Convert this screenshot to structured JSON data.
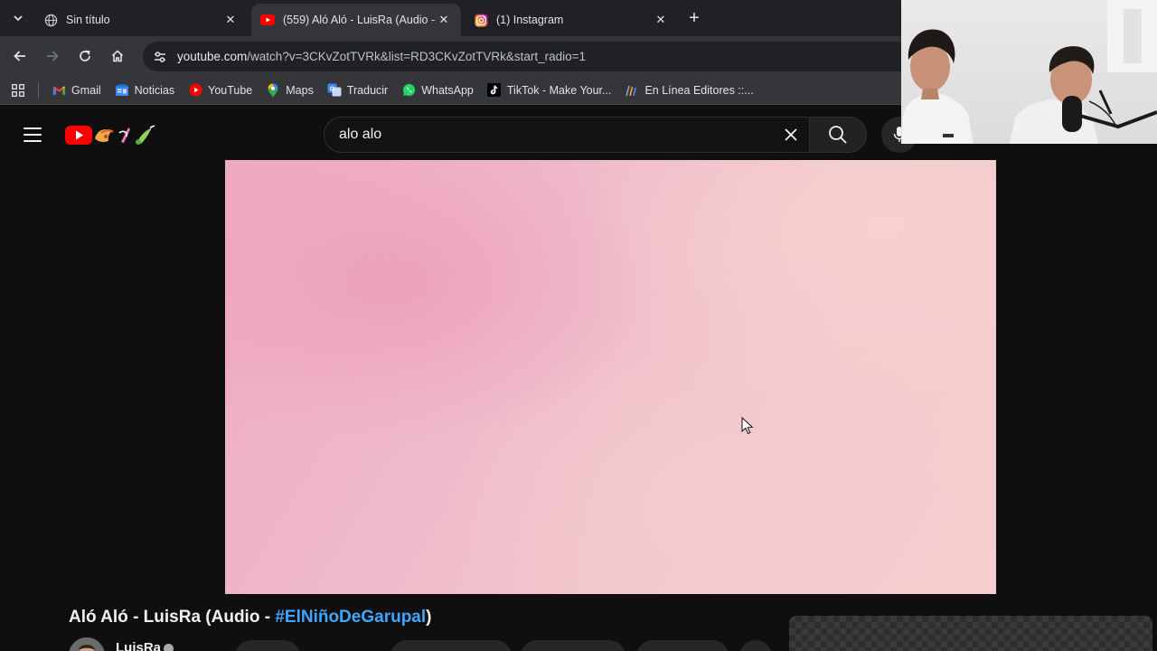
{
  "browser": {
    "tabs": [
      {
        "title": "Sin título",
        "icon": "globe-icon",
        "active": false
      },
      {
        "title": "(559) Aló Aló - LuisRa (Audio - #",
        "icon": "youtube-favicon",
        "active": true
      },
      {
        "title": "(1) Instagram",
        "icon": "instagram-favicon",
        "active": false
      }
    ],
    "url_host": "youtube.com",
    "url_path": "/watch?v=3CKvZotTVRk&list=RD3CKvZotTVRk&start_radio=1",
    "bookmarks": [
      {
        "label": "Gmail",
        "icon": "gmail-icon"
      },
      {
        "label": "Noticias",
        "icon": "news-icon"
      },
      {
        "label": "YouTube",
        "icon": "youtube-icon"
      },
      {
        "label": "Maps",
        "icon": "maps-icon"
      },
      {
        "label": "Traducir",
        "icon": "translate-icon"
      },
      {
        "label": "WhatsApp",
        "icon": "whatsapp-icon"
      },
      {
        "label": "TikTok - Make Your...",
        "icon": "tiktok-icon"
      },
      {
        "label": "En Línea Editores ::...",
        "icon": "editores-icon"
      }
    ]
  },
  "youtube": {
    "search_value": "alo alo",
    "video": {
      "title_main": "Aló Aló - LuisRa (Audio - ",
      "title_hashtag": "#ElNiñoDeGarupal",
      "title_end": ")",
      "channel": "LuisRa"
    }
  },
  "colors": {
    "youtube_red": "#ff0000",
    "hashtag_blue": "#3ea6ff",
    "browser_bg": "#202124",
    "toolbar_bg": "#35363a"
  }
}
